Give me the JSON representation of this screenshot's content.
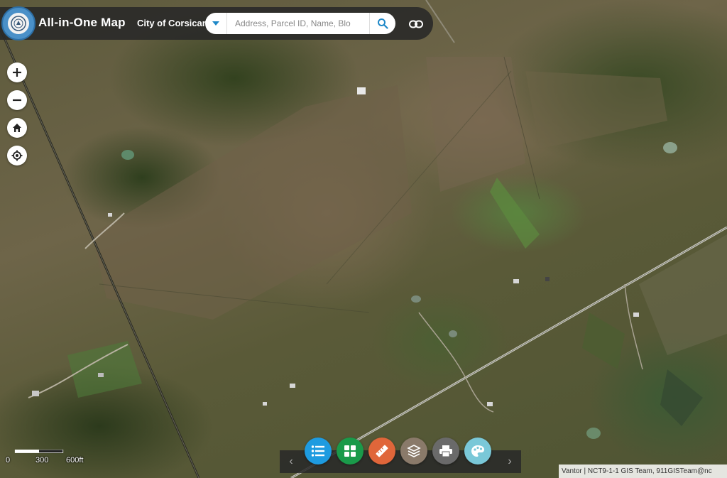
{
  "header": {
    "app_title": "All-in-One Map",
    "city_label": "City of Corsicana",
    "search_placeholder": "Address, Parcel ID, Name, Blo",
    "logo_icon": "city-seal-icon",
    "link_icon": "link-icon"
  },
  "map_controls": [
    {
      "name": "zoom-in-button",
      "glyph": "+"
    },
    {
      "name": "zoom-out-button",
      "glyph": "−"
    },
    {
      "name": "home-button",
      "glyph": "home-icon"
    },
    {
      "name": "locate-button",
      "glyph": "locate-icon"
    }
  ],
  "toolbar": {
    "prev": "‹",
    "next": "›",
    "tools": [
      {
        "name": "layer-list-tool",
        "icon": "list-icon",
        "color": "#1e9be0"
      },
      {
        "name": "basemap-gallery-tool",
        "icon": "grid-icon",
        "color": "#1a9a4a"
      },
      {
        "name": "measure-tool",
        "icon": "ruler-icon",
        "color": "#e0663a"
      },
      {
        "name": "layers-tool",
        "icon": "layers-icon",
        "color": "#8a7a6a"
      },
      {
        "name": "print-tool",
        "icon": "printer-icon",
        "color": "#6a6a6a"
      },
      {
        "name": "draw-tool",
        "icon": "palette-icon",
        "color": "#7ac8d8"
      }
    ]
  },
  "scale": {
    "labels": [
      "0",
      "300",
      "600ft"
    ]
  },
  "attribution": "Vantor | NCT9-1-1 GIS Team, 911GISTeam@nc"
}
